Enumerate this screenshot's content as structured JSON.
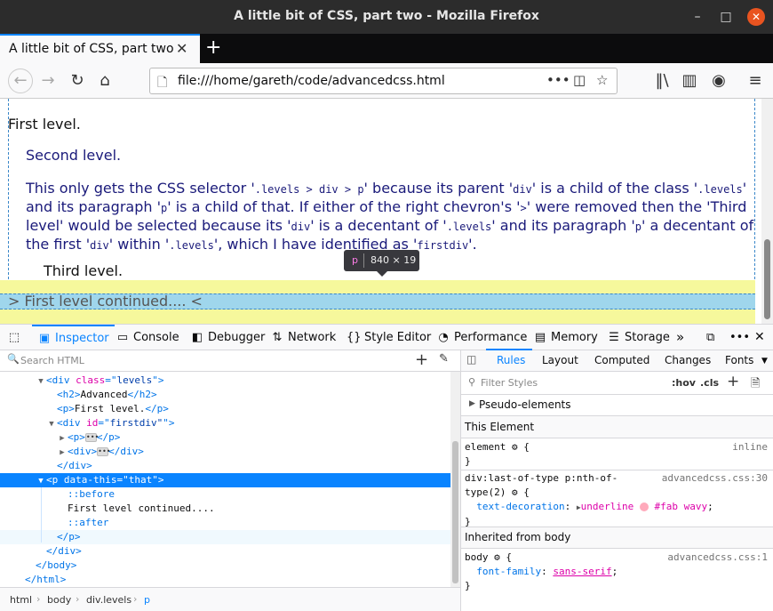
{
  "window": {
    "title": "A little bit of CSS, part two - Mozilla Firefox",
    "min": "–",
    "max": "□",
    "close": "✕"
  },
  "tab": {
    "label": "A little bit of CSS, part two",
    "close": "✕",
    "new": "+"
  },
  "nav": {
    "url": "file:///home/gareth/code/advancedcss.html"
  },
  "page": {
    "first_level": "First level.",
    "second_level": "Second level.",
    "para_parts": [
      "This only gets the CSS selector '",
      ".levels > div > p",
      "' because its parent '",
      "div",
      "' is a child of the class '",
      ".levels",
      "' and its paragraph '",
      "p",
      "' is a child of that. If either of the right chevron's '",
      ">",
      "' were removed then the 'Third level' would be selected because its '",
      "div",
      "' is a decentant of '",
      ".levels",
      "' and its paragraph '",
      "p",
      "' a decentant of the first '",
      "div",
      "' within '",
      ".levels",
      "', which I have identified as '",
      "firstdiv",
      "'."
    ],
    "third_level": "Third level.",
    "continued": "> First level continued.... <"
  },
  "tooltip": {
    "tag": "p",
    "dimensions": "840 × 19"
  },
  "devtools": {
    "tabs": [
      "Inspector",
      "Console",
      "Debugger",
      "Network",
      "Style Editor",
      "Performance",
      "Memory",
      "Storage"
    ],
    "search_placeholder": "Search HTML",
    "markup": [
      {
        "indent": 2,
        "twisty": "▼",
        "html": [
          [
            "t",
            "<div "
          ],
          [
            "a",
            "class"
          ],
          [
            "t",
            "=\""
          ],
          [
            "v",
            "levels"
          ],
          [
            "t",
            "\">"
          ]
        ]
      },
      {
        "indent": 3,
        "twisty": "",
        "html": [
          [
            "t",
            "<h2>"
          ],
          [
            "tx",
            "Advanced"
          ],
          [
            "t",
            "</h2>"
          ]
        ]
      },
      {
        "indent": 3,
        "twisty": "",
        "html": [
          [
            "t",
            "<p>"
          ],
          [
            "tx",
            "First level."
          ],
          [
            "t",
            "</p>"
          ]
        ]
      },
      {
        "indent": 3,
        "twisty": "▼",
        "html": [
          [
            "t",
            "<div "
          ],
          [
            "a",
            "id"
          ],
          [
            "t",
            "=\""
          ],
          [
            "v",
            "firstdiv\""
          ],
          [
            "t",
            "\">"
          ]
        ]
      },
      {
        "indent": 4,
        "twisty": "▶",
        "html": [
          [
            "t",
            "<p>"
          ],
          [
            "e",
            ""
          ],
          [
            "t",
            "</p>"
          ]
        ]
      },
      {
        "indent": 4,
        "twisty": "▶",
        "html": [
          [
            "t",
            "<div>"
          ],
          [
            "e",
            ""
          ],
          [
            "t",
            "</div>"
          ]
        ]
      },
      {
        "indent": 3,
        "twisty": "",
        "html": [
          [
            "t",
            "</div>"
          ]
        ]
      },
      {
        "indent": 2,
        "twisty": "▼",
        "sel": true,
        "html": [
          [
            "t",
            "<p "
          ],
          [
            "a",
            "data-this"
          ],
          [
            "t",
            "=\""
          ],
          [
            "v",
            "that"
          ],
          [
            "t",
            "\">"
          ]
        ]
      },
      {
        "indent": 4,
        "twisty": "",
        "html": [
          [
            "ps",
            "::before"
          ]
        ]
      },
      {
        "indent": 4,
        "twisty": "",
        "html": [
          [
            "tx",
            "First level continued...."
          ]
        ]
      },
      {
        "indent": 4,
        "twisty": "",
        "html": [
          [
            "ps",
            "::after"
          ]
        ]
      },
      {
        "indent": 3,
        "twisty": "",
        "hover": true,
        "html": [
          [
            "t",
            "</p>"
          ]
        ]
      },
      {
        "indent": 2,
        "twisty": "",
        "html": [
          [
            "t",
            "</div>"
          ]
        ]
      },
      {
        "indent": 1,
        "twisty": "",
        "html": [
          [
            "t",
            "</body>"
          ]
        ]
      },
      {
        "indent": 0,
        "twisty": "",
        "html": [
          [
            "t",
            "</html>"
          ]
        ]
      }
    ],
    "breadcrumbs": [
      "html",
      "body",
      "div.levels",
      "p"
    ],
    "right_tabs": [
      "Rules",
      "Layout",
      "Computed",
      "Changes",
      "Fonts"
    ],
    "filter_placeholder": "Filter Styles",
    "hov": ":hov",
    "cls": ".cls",
    "pseudo_elements": "Pseudo-elements",
    "this_element": "This Element",
    "element_selector": "element",
    "element_src": "inline",
    "rule1_selector_line1": "div:last-of-type p:nth-of-",
    "rule1_selector_line2": "type(2)",
    "rule1_src": "advancedcss.css:30",
    "rule1_prop": "text-decoration",
    "rule1_val1": "underline",
    "rule1_val2": "#fab wavy",
    "inherited": "Inherited from body",
    "rule2_selector": "body",
    "rule2_src": "advancedcss.css:1",
    "rule2_prop": "font-family",
    "rule2_val": "sans-serif",
    "colors": {
      "accent": "#0a84ff",
      "highlight_yellow": "#f6f89c",
      "highlight_blue": "#9fd6ec",
      "swatch": "#ffaabb"
    }
  }
}
